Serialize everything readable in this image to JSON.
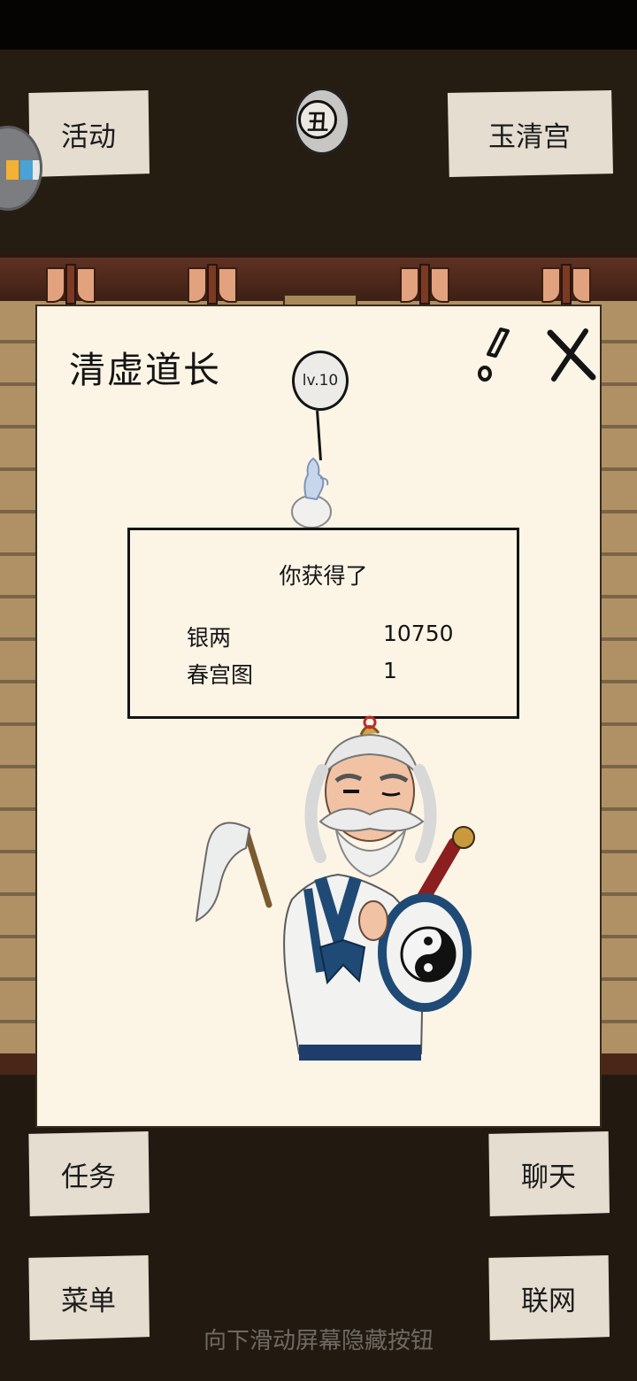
{
  "top_bar": {
    "activity_button": "活动",
    "location_button": "玉清宫",
    "time_glyph": "丑"
  },
  "dialog": {
    "npc_name": "清虚道长",
    "level_label": "lv.10",
    "reward": {
      "title": "你获得了",
      "items": [
        {
          "name": "银两",
          "quantity": "10750"
        },
        {
          "name": "春宫图",
          "quantity": "1"
        }
      ]
    }
  },
  "bottom_bar": {
    "task_button": "任务",
    "chat_button": "聊天",
    "menu_button": "菜单",
    "online_button": "联网"
  },
  "hint": "向下滑动屏幕隐藏按钮",
  "colors": {
    "paper": "#fcf5e6",
    "button_paper": "#e4ddd0",
    "wall": "#b09166",
    "background": "#221a10",
    "robe_blue": "#1f4a75"
  }
}
